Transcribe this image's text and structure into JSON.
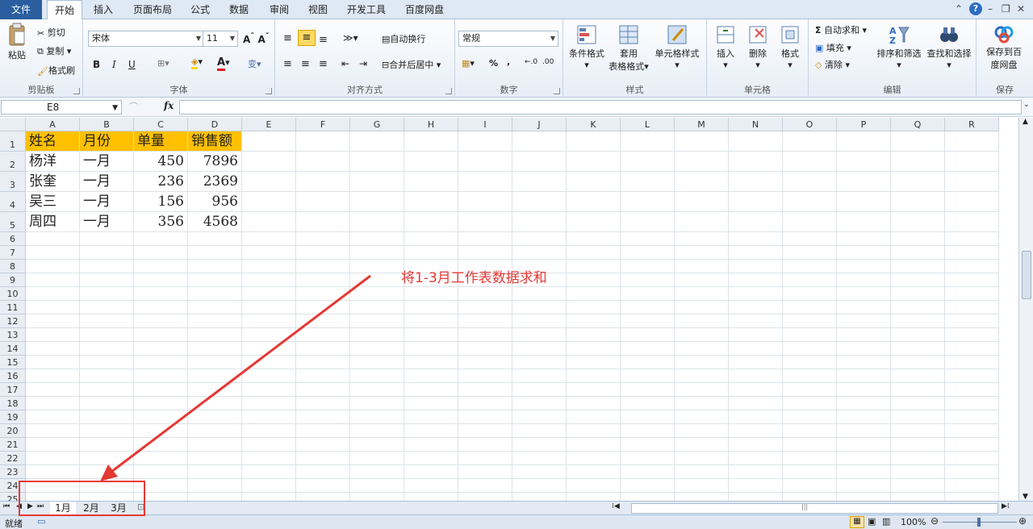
{
  "ribbon_tabs": [
    "文件",
    "开始",
    "插入",
    "页面布局",
    "公式",
    "数据",
    "审阅",
    "视图",
    "开发工具",
    "百度网盘"
  ],
  "ribbon": {
    "clipboard": {
      "paste": "粘贴",
      "cut": "剪切",
      "copy": "复制",
      "format_painter": "格式刷",
      "label": "剪贴板"
    },
    "font": {
      "name": "宋体",
      "size": "11",
      "bold": "B",
      "italic": "I",
      "underline": "U",
      "wen": "变",
      "label": "字体"
    },
    "alignment": {
      "wrap": "自动换行",
      "merge": "合并后居中",
      "label": "对齐方式"
    },
    "number": {
      "format": "常规",
      "percent": "%",
      "comma": ",",
      "inc": "+.0 .00",
      "dec": ".00 →.0",
      "label": "数字"
    },
    "styles": {
      "conditional": "条件格式",
      "table1": "套用",
      "table2": "表格格式",
      "cell_styles": "单元格样式",
      "label": "样式"
    },
    "cells": {
      "insert": "插入",
      "delete": "删除",
      "format": "格式",
      "label": "单元格"
    },
    "editing": {
      "autosum": "自动求和",
      "fill": "填充",
      "clear": "清除",
      "sort": "排序和筛选",
      "find": "查找和选择",
      "label": "编辑"
    },
    "save": {
      "line1": "保存到百",
      "line2": "度网盘",
      "label": "保存"
    }
  },
  "formula_bar": {
    "name_box": "E8",
    "fx": "fx",
    "formula": ""
  },
  "columns": [
    "A",
    "B",
    "C",
    "D",
    "E",
    "F",
    "G",
    "H",
    "I",
    "J",
    "K",
    "L",
    "M",
    "N",
    "O",
    "P",
    "Q",
    "R"
  ],
  "rows": [
    "1",
    "2",
    "3",
    "4",
    "5",
    "6",
    "7",
    "8",
    "9",
    "10",
    "11",
    "12",
    "13",
    "14",
    "15",
    "16",
    "17",
    "18",
    "19",
    "20",
    "21",
    "22",
    "23",
    "24",
    "25"
  ],
  "table": {
    "headers": [
      "姓名",
      "月份",
      "单量",
      "销售额"
    ],
    "data": [
      [
        "杨洋",
        "一月",
        "450",
        "7896"
      ],
      [
        "张奎",
        "一月",
        "236",
        "2369"
      ],
      [
        "吴三",
        "一月",
        "156",
        "956"
      ],
      [
        "周四",
        "一月",
        "356",
        "4568"
      ]
    ]
  },
  "sheets": [
    "1月",
    "2月",
    "3月"
  ],
  "active_sheet": 0,
  "status": {
    "ready": "就绪",
    "zoom": "100%"
  },
  "annotation": {
    "text": "将1-3月工作表数据求和",
    "color": "#e53935"
  },
  "colors": {
    "header_fill": "#ffc000",
    "file_tab": "#2a5e9e"
  }
}
